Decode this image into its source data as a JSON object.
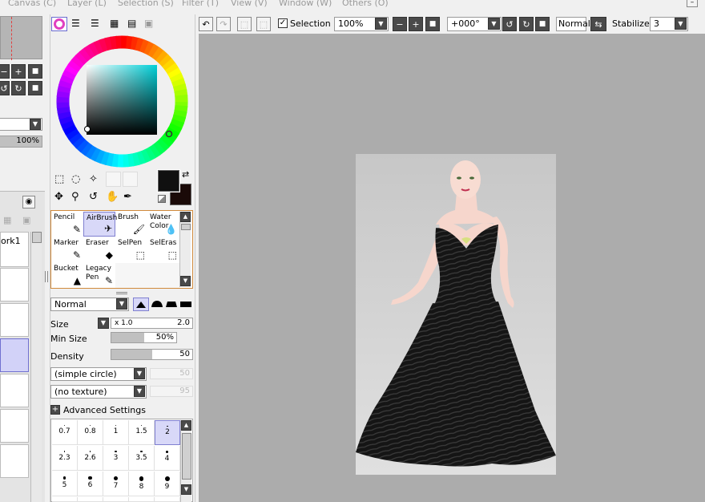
{
  "menu": [
    "Canvas (C)",
    "Layer (L)",
    "Selection (S)",
    "Filter (T)",
    "View (V)",
    "Window (W)",
    "Others (O)"
  ],
  "toolbar": {
    "selection_label": "Selection",
    "selection_checked": true,
    "zoom": "100%",
    "rotation": "+000°",
    "blend_mode": "Normal",
    "stabilizer_label": "Stabilizer",
    "stabilizer_value": "3"
  },
  "left_panel": {
    "opacity_value": "100%",
    "layer_name": "ork1"
  },
  "colors": {
    "primary": "#101010",
    "secondary": "#1a0a08",
    "hue": "#00c8c8"
  },
  "tools": [
    {
      "label": "Pencil",
      "icon": "pencil-icon",
      "glyph": "✎"
    },
    {
      "label": "AirBrush",
      "icon": "airbrush-icon",
      "glyph": "✈"
    },
    {
      "label": "Brush",
      "icon": "brush-icon",
      "glyph": "🖌"
    },
    {
      "label": "Water Color",
      "icon": "watercolor-icon",
      "glyph": "💧"
    },
    {
      "label": "Marker",
      "icon": "marker-icon",
      "glyph": "✎"
    },
    {
      "label": "Eraser",
      "icon": "eraser-icon",
      "glyph": "◆"
    },
    {
      "label": "SelPen",
      "icon": "selpen-icon",
      "glyph": "⬚"
    },
    {
      "label": "SelEras",
      "icon": "seleras-icon",
      "glyph": "⬚"
    },
    {
      "label": "Bucket",
      "icon": "bucket-icon",
      "glyph": "▲"
    },
    {
      "label": "Legacy Pen",
      "icon": "legacy-pen-icon",
      "glyph": "✎"
    }
  ],
  "brush_settings": {
    "blend_mode": "Normal",
    "size_label": "Size",
    "size_multiplier": "x 1.0",
    "size_value": "2.0",
    "min_size_label": "Min Size",
    "min_size_value": "50%",
    "min_size_fraction": 0.5,
    "density_label": "Density",
    "density_value": "50",
    "density_fraction": 0.5,
    "shape": "(simple circle)",
    "shape_value": "50",
    "texture": "(no texture)",
    "texture_value": "95",
    "advanced_label": "Advanced Settings"
  },
  "brush_sizes": [
    "0.7",
    "0.8",
    "1",
    "1.5",
    "2",
    "2.3",
    "2.6",
    "3",
    "3.5",
    "4",
    "5",
    "6",
    "7",
    "8",
    "9"
  ]
}
